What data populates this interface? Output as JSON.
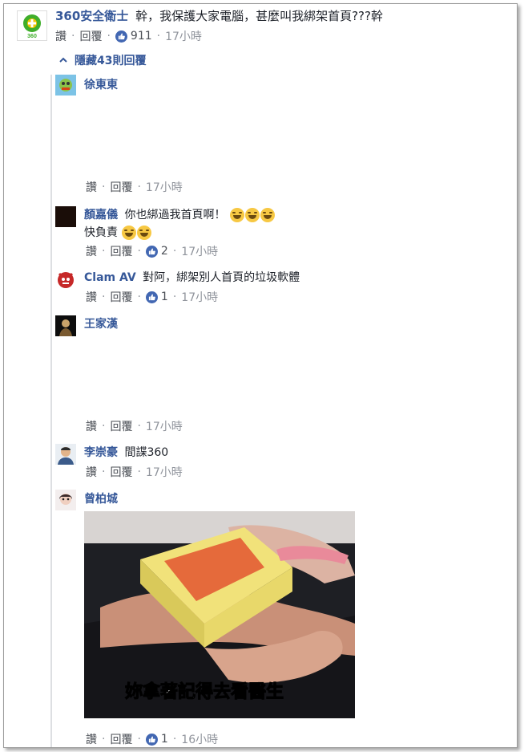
{
  "actions": {
    "like": "讚",
    "reply": "回覆",
    "sep": "·"
  },
  "top_comment": {
    "author": "360安全衛士",
    "text": "幹，我保護大家電腦，甚麼叫我綁架首頁???幹",
    "likes": "911",
    "time": "17小時",
    "avatar_label": "360"
  },
  "hidden_replies": {
    "label": "隱藏43則回覆"
  },
  "replies": [
    {
      "author": "徐東東",
      "text": "",
      "time": "17小時",
      "likes": ""
    },
    {
      "author": "顏嘉儀",
      "text_line1": "你也綁過我首頁啊！",
      "text_line2": "快負責",
      "likes": "2",
      "time": "17小時"
    },
    {
      "author": "Clam AV",
      "text": "對阿，綁架別人首頁的垃圾軟體",
      "likes": "1",
      "time": "17小時"
    },
    {
      "author": "王家漢",
      "text": "",
      "time": "17小時",
      "likes": ""
    },
    {
      "author": "李崇豪",
      "text": "間諜360",
      "time": "17小時",
      "likes": ""
    },
    {
      "author": "曾柏城",
      "image_caption": "妳拿著記得去看醫生",
      "likes": "1",
      "time": "16小時"
    }
  ],
  "icons": {
    "like": "thumbs-up-icon",
    "chevron": "chevron-up-icon",
    "emoji": "tears-of-joy-emoji"
  },
  "colors": {
    "name": "#365899",
    "like_badge": "#4267b2",
    "meta": "#90949c"
  }
}
